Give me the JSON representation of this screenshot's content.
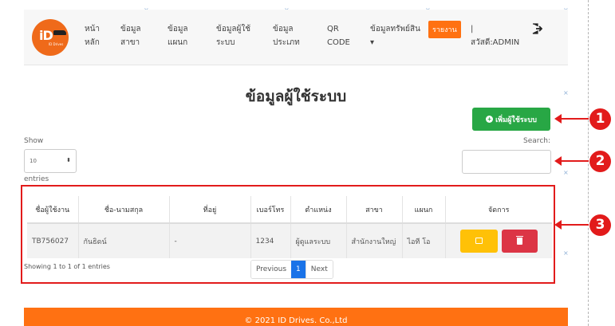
{
  "nav": {
    "logo": {
      "mark": "iD",
      "sub": "ID Drives"
    },
    "items": [
      {
        "l1": "หน้า",
        "l2": "หลัก"
      },
      {
        "l1": "ข้อมูล",
        "l2": "สาขา"
      },
      {
        "l1": "ข้อมูล",
        "l2": "แผนก"
      },
      {
        "l1": "ข้อมูลผู้ใช้",
        "l2": "ระบบ"
      },
      {
        "l1": "ข้อมูล",
        "l2": "ประเภท"
      },
      {
        "l1": "QR",
        "l2": "CODE"
      },
      {
        "l1": "ข้อมูลทรัพย์สิน",
        "l2": "▾"
      }
    ],
    "report": "รายงาน",
    "welcome_sep": "|",
    "welcome": "สวัสดี:ADMIN"
  },
  "page": {
    "title": "ข้อมูลผู้ใช้ระบบ"
  },
  "toolbar": {
    "add_label": "เพิ่มผู้ใช้ระบบ",
    "add_icon": "+"
  },
  "controls": {
    "show_label": "Show",
    "length_value": "10",
    "length_arrow": "⬍",
    "entries_label": "entries",
    "search_label": "Search:"
  },
  "table": {
    "columns": [
      "ชื่อผู้ใช้งาน",
      "ชื่อ-นามสกุล",
      "ที่อยู่",
      "เบอร์โทร",
      "ตำแหน่ง",
      "สาขา",
      "แผนก",
      "จัดการ"
    ],
    "rows": [
      {
        "username": "TB756027",
        "fullname": "กันธิดน์",
        "address": "-",
        "phone": "1234",
        "position": "ผู้ดูแลระบบ",
        "branch": "สำนักงานใหญ่",
        "dept": "ไอที โอ"
      }
    ]
  },
  "footer_info": "Showing 1 to 1 of 1 entries",
  "pagination": {
    "prev": "Previous",
    "current": "1",
    "next": "Next"
  },
  "footer": "© 2021 ID Drives. Co.,Ltd",
  "annotations": {
    "b1": "1",
    "b2": "2",
    "b3": "3"
  },
  "colors": {
    "primary": "#ff7112",
    "success": "#28a745",
    "warning": "#ffc107",
    "danger": "#dc3545",
    "annotation": "#e21b1b"
  }
}
